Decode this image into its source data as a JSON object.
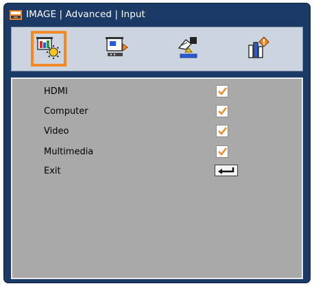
{
  "title": "IMAGE | Advanced | Input",
  "tabs": [
    {
      "icon": "image-settings-icon",
      "active": true
    },
    {
      "icon": "display-settings-icon",
      "active": false
    },
    {
      "icon": "setup-settings-icon",
      "active": false
    },
    {
      "icon": "options-settings-icon",
      "active": false
    }
  ],
  "menu": [
    {
      "label": "HDMI",
      "checked": true
    },
    {
      "label": "Computer",
      "checked": true
    },
    {
      "label": "Video",
      "checked": true
    },
    {
      "label": "Multimedia",
      "checked": true
    },
    {
      "label": "Exit",
      "control": "enter-key"
    }
  ],
  "colors": {
    "frame": "#1b3a66",
    "tab_highlight": "#f58a24",
    "panel": "#a9a9a9",
    "check": "#f58a24"
  }
}
